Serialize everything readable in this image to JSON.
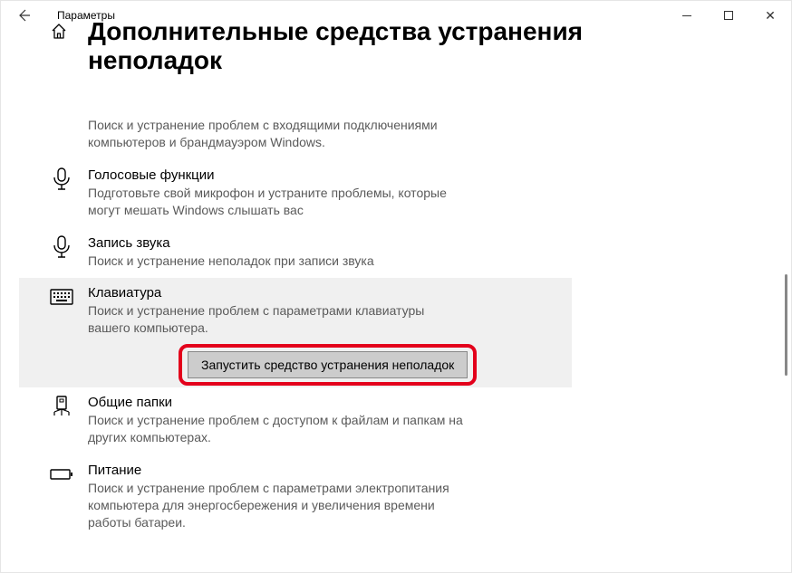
{
  "window": {
    "title": "Параметры"
  },
  "page": {
    "title": "Дополнительные средства устранения неполадок"
  },
  "items": {
    "incoming": {
      "desc": "Поиск и устранение проблем с входящими подключениями компьютеров и брандмауэром Windows."
    },
    "voice": {
      "label": "Голосовые функции",
      "desc": "Подготовьте свой микрофон и устраните проблемы, которые могут мешать Windows слышать вас"
    },
    "recording": {
      "label": "Запись звука",
      "desc": "Поиск и устранение неполадок при записи звука"
    },
    "keyboard": {
      "label": "Клавиатура",
      "desc": "Поиск и устранение проблем с параметрами клавиатуры вашего компьютера.",
      "button": "Запустить средство устранения неполадок"
    },
    "shared": {
      "label": "Общие папки",
      "desc": "Поиск и устранение проблем с доступом к файлам и папкам на других компьютерах."
    },
    "power": {
      "label": "Питание",
      "desc": "Поиск и устранение проблем с параметрами электропитания компьютера для энергосбережения и увеличения  времени работы батареи."
    }
  }
}
